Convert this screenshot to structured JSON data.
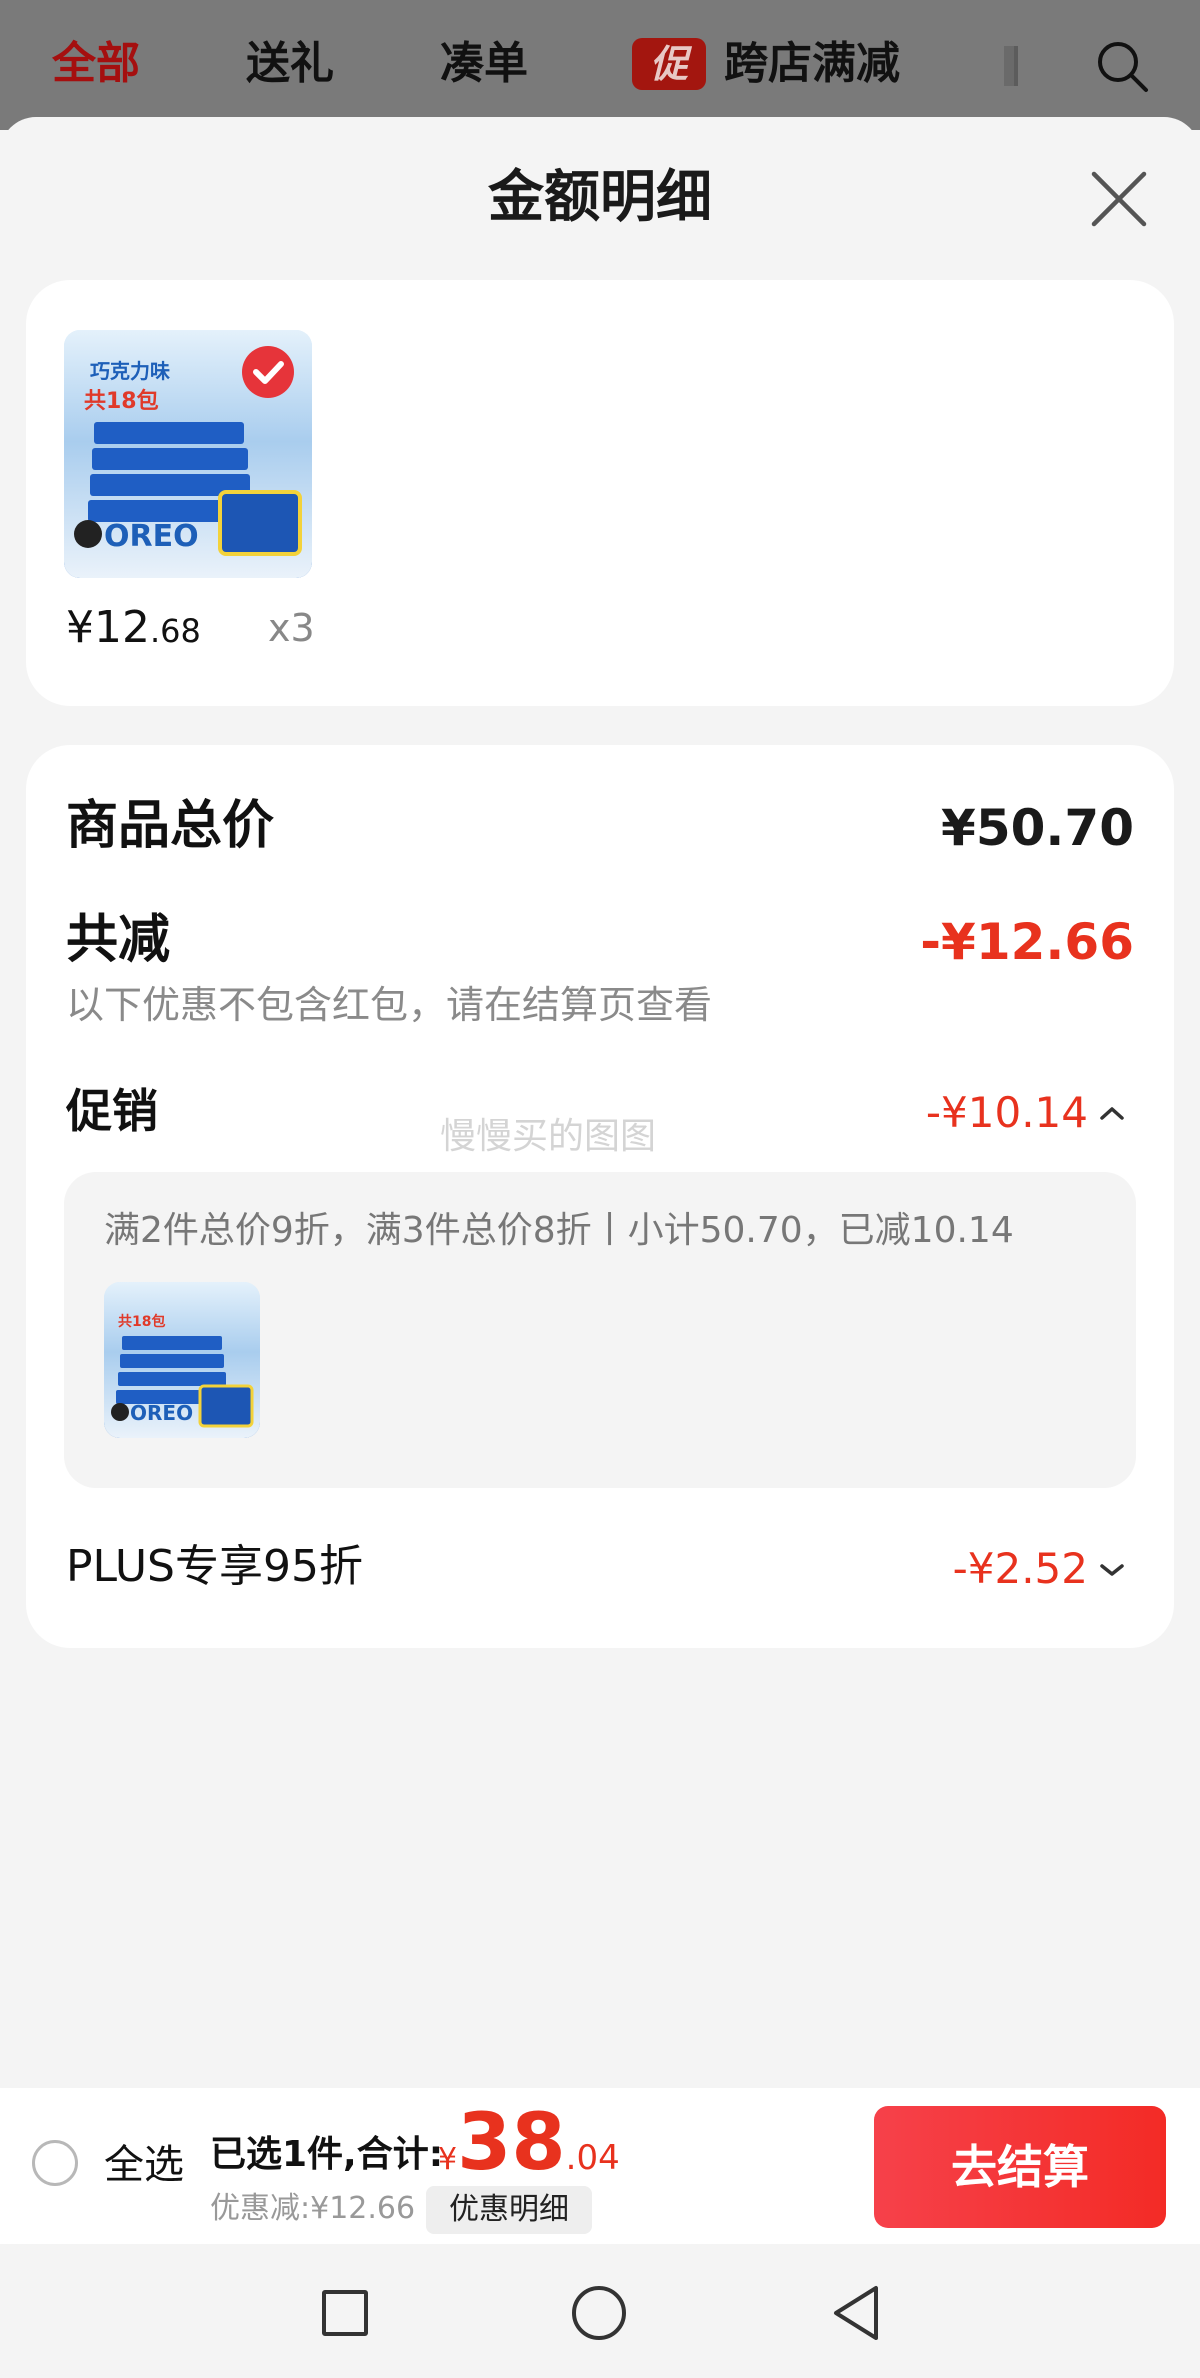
{
  "top_tabs": [
    {
      "label": "全部"
    },
    {
      "label": "送礼"
    },
    {
      "label": "凑单"
    },
    {
      "label": "跨店满减",
      "badge": "促"
    }
  ],
  "sheet": {
    "title": "金额明细"
  },
  "product": {
    "price_int": "¥12",
    "price_dec": ".68",
    "qty": "x3"
  },
  "summary": {
    "total_label": "商品总价",
    "total_value": "¥50.70",
    "reduce_label": "共减",
    "reduce_value": "-¥12.66",
    "reduce_note": "以下优惠不包含红包，请在结算页查看",
    "promo_label": "促销",
    "promo_value": "-¥10.14",
    "promo_desc": "满2件总价9折，满3件总价8折丨小计50.70，已减10.14",
    "plus_label": "PLUS专享95折",
    "plus_value": "-¥2.52",
    "watermark": "慢慢买的图图"
  },
  "checkout": {
    "select_all": "全选",
    "selected_text": "已选1件,合计:",
    "currency": "¥",
    "total_int": "38",
    "total_dec": ".04",
    "discount_text": "优惠减:¥12.66",
    "detail_button": "优惠明细",
    "checkout_button": "去结算"
  },
  "thumb_text": {
    "flavor": "巧克力味",
    "count": "共18包",
    "brand": "OREO"
  },
  "colors": {
    "accent_red": "#e8321e",
    "active_tab": "#a50f0f",
    "checkout_button": "#f32b26"
  }
}
